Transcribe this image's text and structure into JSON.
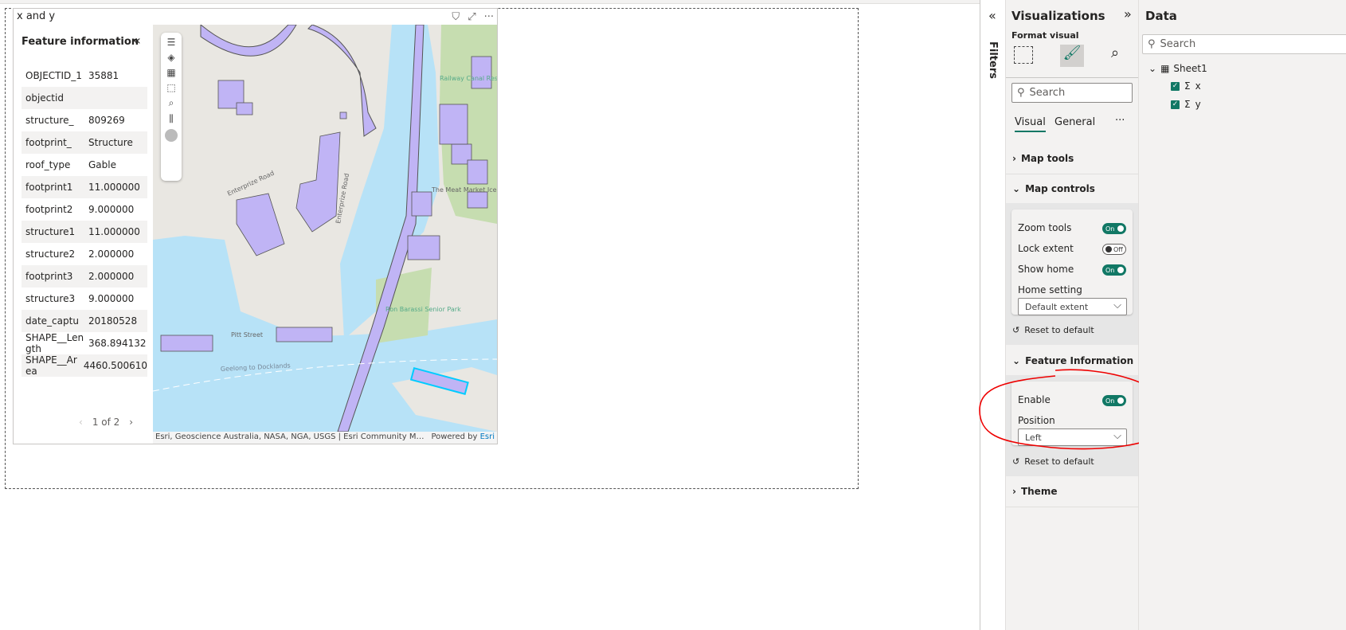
{
  "visual": {
    "title": "x and y",
    "icons": [
      "filter-icon",
      "focus-mode-icon",
      "more-options-icon"
    ],
    "more": "···"
  },
  "feature_info": {
    "title": "Feature information",
    "collapse": "«",
    "rows": [
      {
        "k": "OBJECTID_1",
        "v": "35881"
      },
      {
        "k": "objectid",
        "v": ""
      },
      {
        "k": "structure_",
        "v": "809269"
      },
      {
        "k": "footprint_",
        "v": "Structure"
      },
      {
        "k": "roof_type",
        "v": "Gable"
      },
      {
        "k": "footprint1",
        "v": "11.000000"
      },
      {
        "k": "footprint2",
        "v": "9.000000"
      },
      {
        "k": "structure1",
        "v": "11.000000"
      },
      {
        "k": "structure2",
        "v": "2.000000"
      },
      {
        "k": "footprint3",
        "v": "2.000000"
      },
      {
        "k": "structure3",
        "v": "9.000000"
      },
      {
        "k": "date_captu",
        "v": "20180528"
      },
      {
        "k": "SHAPE__Length",
        "v": "368.894132"
      },
      {
        "k": "SHAPE__Area",
        "v": "4460.500610"
      }
    ],
    "pager": {
      "prev": "‹",
      "text": "1 of 2",
      "next": "›"
    }
  },
  "map": {
    "labels": {
      "road": "Enterprize Road",
      "reserve": "Railway Canal Reserve",
      "park": "Ron Barassi Senior Park",
      "pitt": "Pitt Street",
      "ferry": "Geelong to Docklands",
      "meat": "The Meat Market Icehouse",
      "rd2": "Rd"
    },
    "attribution": "Esri, Geoscience Australia, NASA, NGA, USGS | Esri Community Maps Contributors",
    "powered": "Powered by ",
    "esri": "Esri",
    "colors": {
      "water": "#b7e2f7",
      "land": "#e9e7e2",
      "building": "#c0b4f5",
      "park": "#c6ddb0"
    }
  },
  "filters": {
    "label": "Filters",
    "collapse": "«"
  },
  "viz": {
    "title": "Visualizations",
    "expand": "»",
    "format_visual": "Format visual",
    "search": "Search",
    "tabs": [
      "Visual",
      "General"
    ],
    "more": "···",
    "sections": {
      "map_tools": "Map tools",
      "map_controls": "Map controls",
      "feature_info": "Feature Information",
      "theme": "Theme"
    },
    "map_controls": {
      "zoom_tools": "Zoom tools",
      "zoom_tools_state": "On",
      "lock_extent": "Lock extent",
      "lock_extent_state": "Off",
      "show_home": "Show home",
      "show_home_state": "On",
      "home_setting": "Home setting",
      "home_setting_value": "Default extent"
    },
    "feature": {
      "enable": "Enable",
      "enable_state": "On",
      "position": "Position",
      "position_value": "Left"
    },
    "reset": "Reset to default"
  },
  "data": {
    "title": "Data",
    "search": "Search",
    "table": "Sheet1",
    "fields": [
      {
        "name": "x",
        "checked": true
      },
      {
        "name": "y",
        "checked": true
      }
    ],
    "sigma": "Σ"
  },
  "accent": "#117865"
}
